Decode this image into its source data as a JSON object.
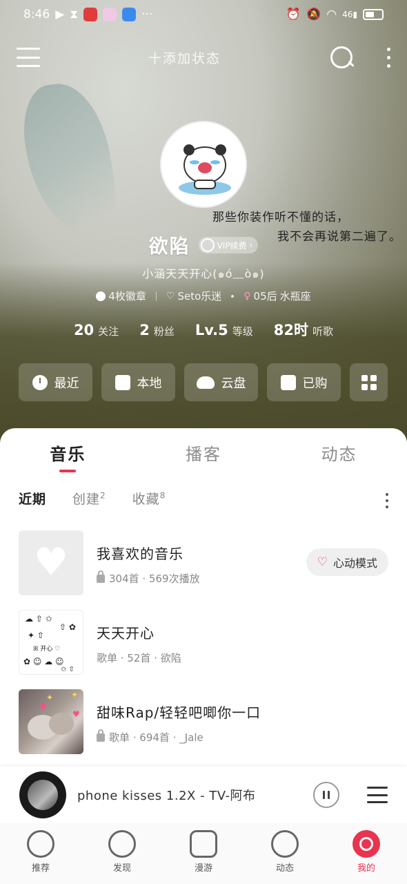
{
  "status_bar": {
    "time": "8:46",
    "network": "46"
  },
  "top_bar": {
    "add_status": "十添加状态"
  },
  "profile": {
    "username": "欲陷",
    "vip_label": "VIP续费",
    "signature": "小涵天天开心(๑ó﹏ò๑)",
    "quote_line1": "那些你装作听不懂的话，",
    "quote_line2": "我不会再说第二遍了。",
    "tags": {
      "badges": "4枚徽章",
      "fan": "Seto乐迷",
      "age": "05后",
      "zodiac": "水瓶座"
    },
    "stats": [
      {
        "value": "20",
        "label": "关注"
      },
      {
        "value": "2",
        "label": "粉丝"
      },
      {
        "value": "Lv.5",
        "label": "等级"
      },
      {
        "value": "82时",
        "label": "听歌"
      }
    ]
  },
  "quick_actions": [
    "最近",
    "本地",
    "云盘",
    "已购"
  ],
  "main_tabs": [
    "音乐",
    "播客",
    "动态"
  ],
  "sub_tabs": [
    {
      "label": "近期",
      "count": ""
    },
    {
      "label": "创建",
      "count": "2"
    },
    {
      "label": "收藏",
      "count": "8"
    }
  ],
  "playlists": [
    {
      "title": "我喜欢的音乐",
      "meta": "304首 · 569次播放",
      "locked": true,
      "cover": "heart"
    },
    {
      "title": "天天开心",
      "meta": "歌单 · 52首 · 欲陷",
      "locked": false,
      "cover": "doodle"
    },
    {
      "title": "甜味Rap/轻轻吧唧你一口",
      "meta": "歌单 · 694首 · _Jale",
      "locked": true,
      "cover": "cat"
    }
  ],
  "heart_mode_label": "心动模式",
  "mini_player": {
    "track": "phone kisses 1.2X - TV-阿布"
  },
  "bottom_nav": [
    {
      "label": "推荐",
      "icon": "recommend-icon",
      "active": false
    },
    {
      "label": "发现",
      "icon": "compass-icon",
      "active": false
    },
    {
      "label": "漫游",
      "icon": "radio-icon",
      "active": false
    },
    {
      "label": "动态",
      "icon": "chat-icon",
      "active": false
    },
    {
      "label": "我的",
      "icon": "user-icon",
      "active": true
    }
  ],
  "colors": {
    "accent": "#e8344e"
  }
}
